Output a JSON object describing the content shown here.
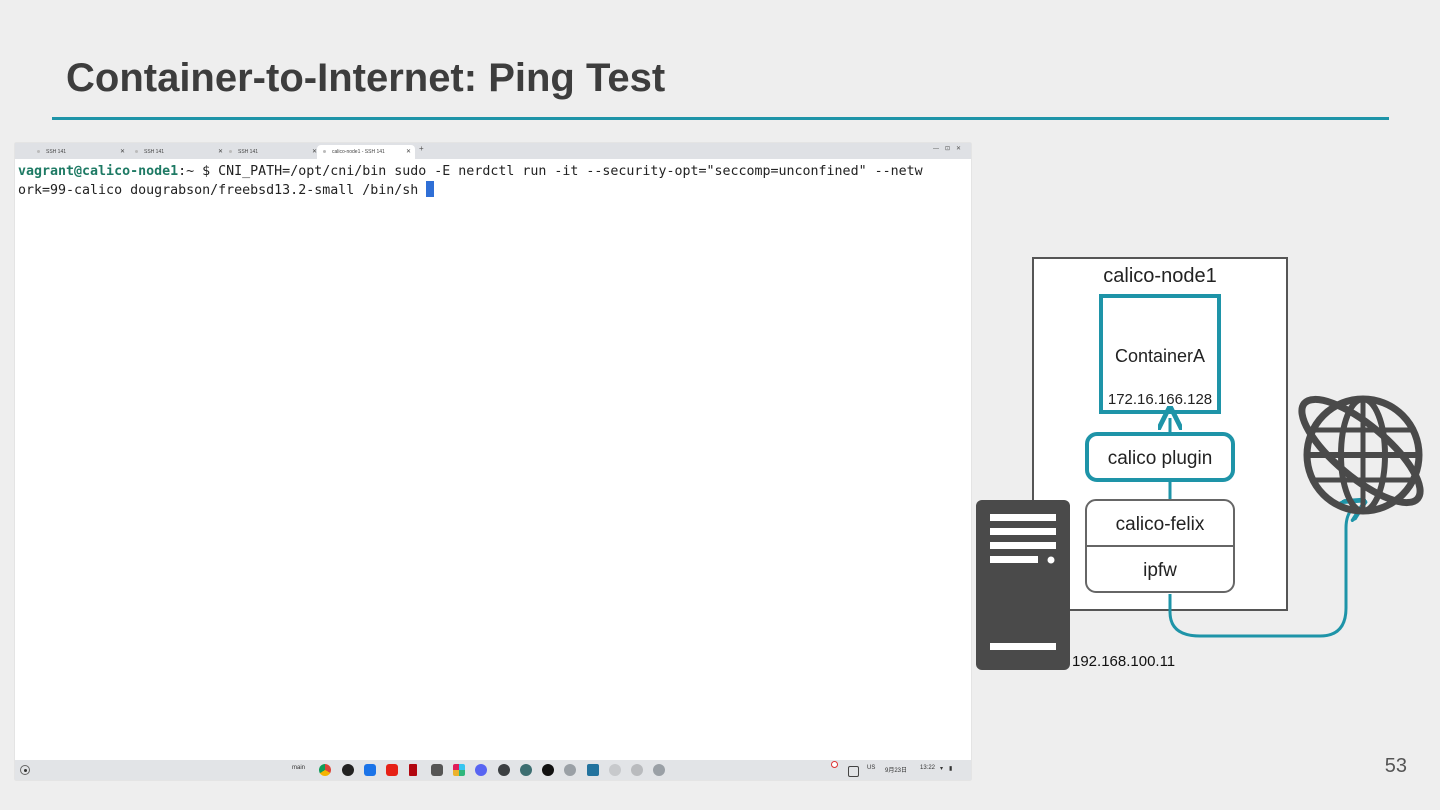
{
  "slide": {
    "title": "Container-to-Internet: Ping Test",
    "page_number": "53",
    "accent_color": "#1e94a8"
  },
  "terminal_window": {
    "tabs": [
      {
        "label": "SSH 141",
        "active": false
      },
      {
        "label": "SSH 141",
        "active": false
      },
      {
        "label": "SSH 141",
        "active": false
      },
      {
        "label": "calico-node1 - SSH 141",
        "active": true
      }
    ],
    "new_tab": "+",
    "prompt_user": "vagrant@calico-node1",
    "prompt_rest": ":~ $ ",
    "command_line1": "CNI_PATH=/opt/cni/bin sudo -E nerdctl run -it --security-opt=\"seccomp=unconfined\" --netw",
    "command_line2": "ork=99-calico dougrabson/freebsd13.2-small /bin/sh "
  },
  "taskbar": {
    "shelf_label": "main",
    "icons": [
      "chrome-icon",
      "gnome-icon",
      "files-icon",
      "youtube-icon",
      "netflix-icon",
      "security-icon",
      "slack-icon",
      "discord-icon",
      "terminal-icon",
      "code-icon",
      "github-icon",
      "extension-icon",
      "vscode-icon",
      "plus-icon",
      "app-icon",
      "settings-icon"
    ],
    "tray": {
      "lang": "US",
      "date": "9月23日",
      "time": "13:22"
    }
  },
  "diagram": {
    "node_label": "calico-node1",
    "container_name": "ContainerA",
    "container_ip": "172.16.166.128",
    "plugin_label": "calico plugin",
    "felix_label": "calico-felix",
    "ipfw_label": "ipfw",
    "host_ip": "192.168.100.11",
    "teal": "#1e94a8",
    "dark": "#4a4a4a"
  }
}
